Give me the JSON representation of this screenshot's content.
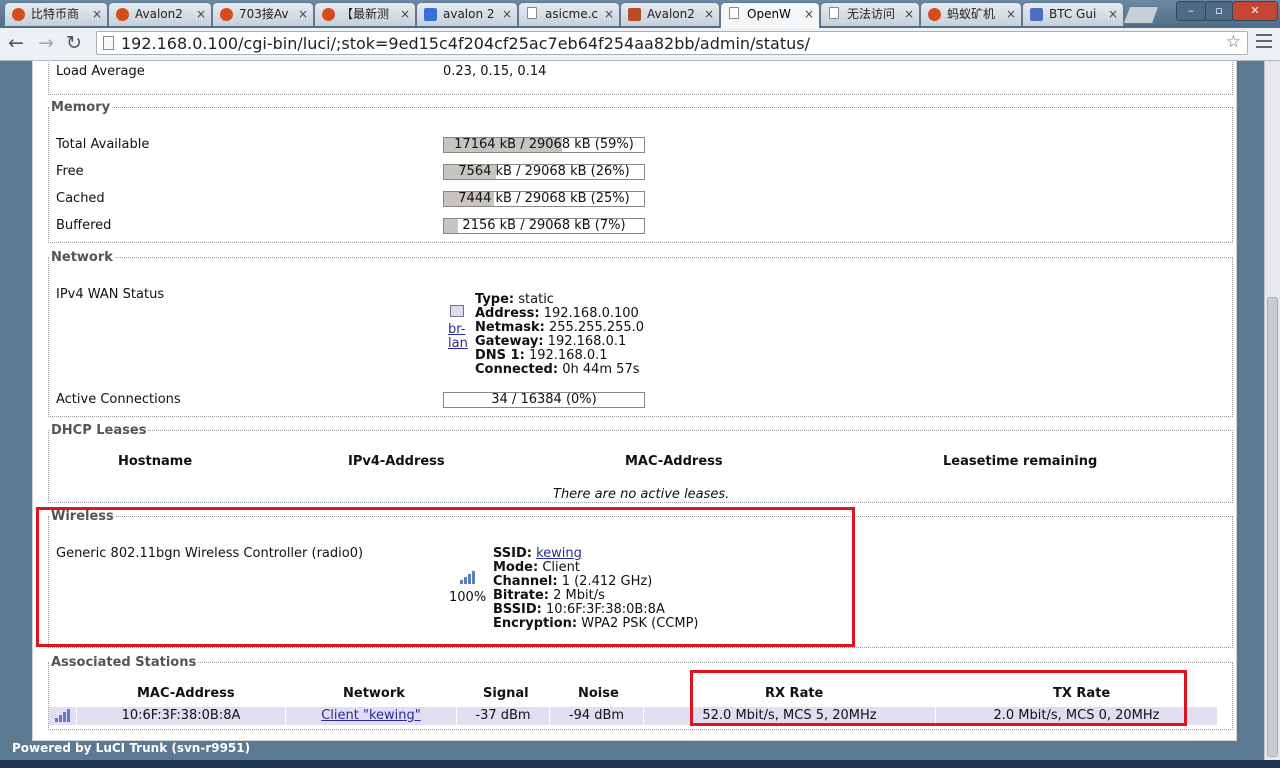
{
  "browser": {
    "tabs": [
      {
        "label": "比特币商",
        "icon": "tab-favicon-orange"
      },
      {
        "label": "Avalon2",
        "icon": "tab-favicon-orange"
      },
      {
        "label": "703接Av",
        "icon": "tab-favicon-orange"
      },
      {
        "label": "【最新测",
        "icon": "tab-favicon-orange"
      },
      {
        "label": "avalon 2",
        "icon": "tab-favicon-google"
      },
      {
        "label": "asicme.c",
        "icon": "tab-favicon-page"
      },
      {
        "label": "Avalon2",
        "icon": "tab-favicon-image"
      },
      {
        "label": "OpenW",
        "icon": "tab-favicon-page",
        "active": true
      },
      {
        "label": "无法访问",
        "icon": "tab-favicon-page"
      },
      {
        "label": "蚂蚁矿机",
        "icon": "tab-favicon-orange"
      },
      {
        "label": "BTC Gui",
        "icon": "tab-favicon-btc"
      }
    ],
    "tab_close_glyph": "×",
    "url": "192.168.0.100/cgi-bin/luci/;stok=9ed15c4f204cf25ac7eb64f254aa82bb/admin/status/",
    "nav": {
      "back": "←",
      "forward": "→",
      "reload": "↻",
      "star": "☆"
    },
    "window": {
      "minimize": "–",
      "maximize": "▫",
      "close": "✕"
    }
  },
  "system": {
    "load_average_label": "Load Average",
    "load_average_value": "0.23, 0.15, 0.14"
  },
  "memory": {
    "title": "Memory",
    "rows": [
      {
        "label": "Total Available",
        "text": "17164 kB / 29068 kB (59%)",
        "percent": 59
      },
      {
        "label": "Free",
        "text": "7564 kB / 29068 kB (26%)",
        "percent": 26
      },
      {
        "label": "Cached",
        "text": "7444 kB / 29068 kB (25%)",
        "percent": 25
      },
      {
        "label": "Buffered",
        "text": "2156 kB / 29068 kB (7%)",
        "percent": 7
      }
    ]
  },
  "network": {
    "title": "Network",
    "wan_label": "IPv4 WAN Status",
    "iface_link_line1": "br-",
    "iface_link_line2": "lan",
    "wan": [
      {
        "key": "Type:",
        "value": "static"
      },
      {
        "key": "Address:",
        "value": "192.168.0.100"
      },
      {
        "key": "Netmask:",
        "value": "255.255.255.0"
      },
      {
        "key": "Gateway:",
        "value": "192.168.0.1"
      },
      {
        "key": "DNS 1:",
        "value": "192.168.0.1"
      },
      {
        "key": "Connected:",
        "value": "0h 44m 57s"
      }
    ],
    "active_connections_label": "Active Connections",
    "active_connections_text": "34 / 16384 (0%)",
    "active_connections_percent": 0
  },
  "dhcp": {
    "title": "DHCP Leases",
    "headers": [
      "Hostname",
      "IPv4-Address",
      "MAC-Address",
      "Leasetime remaining"
    ],
    "empty_text": "There are no active leases."
  },
  "wireless": {
    "title": "Wireless",
    "device_label": "Generic 802.11bgn Wireless Controller (radio0)",
    "signal_percent_text": "100%",
    "ssid_key": "SSID:",
    "ssid_value": "kewing",
    "details": [
      {
        "key": "Mode:",
        "value": "Client"
      },
      {
        "key": "Channel:",
        "value": "1 (2.412 GHz)"
      },
      {
        "key": "Bitrate:",
        "value": "2 Mbit/s"
      },
      {
        "key": "BSSID:",
        "value": "10:6F:3F:38:0B:8A"
      },
      {
        "key": "Encryption:",
        "value": "WPA2 PSK (CCMP)"
      }
    ]
  },
  "stations": {
    "title": "Associated Stations",
    "headers": [
      "MAC-Address",
      "Network",
      "Signal",
      "Noise",
      "RX Rate",
      "TX Rate"
    ],
    "rows": [
      {
        "mac": "10:6F:3F:38:0B:8A",
        "network": "Client \"kewing\"",
        "signal": "-37 dBm",
        "noise": "-94 dBm",
        "rx": "52.0 Mbit/s, MCS 5, 20MHz",
        "tx": "2.0 Mbit/s, MCS 0, 20MHz"
      }
    ]
  },
  "footer": {
    "text": "Powered by LuCI Trunk (svn-r9951)"
  },
  "colors": {
    "highlight": "#e0141e",
    "row_bg": "#e2def2",
    "bar_fill": "#c8c4c0",
    "link": "#2a2a9a"
  }
}
